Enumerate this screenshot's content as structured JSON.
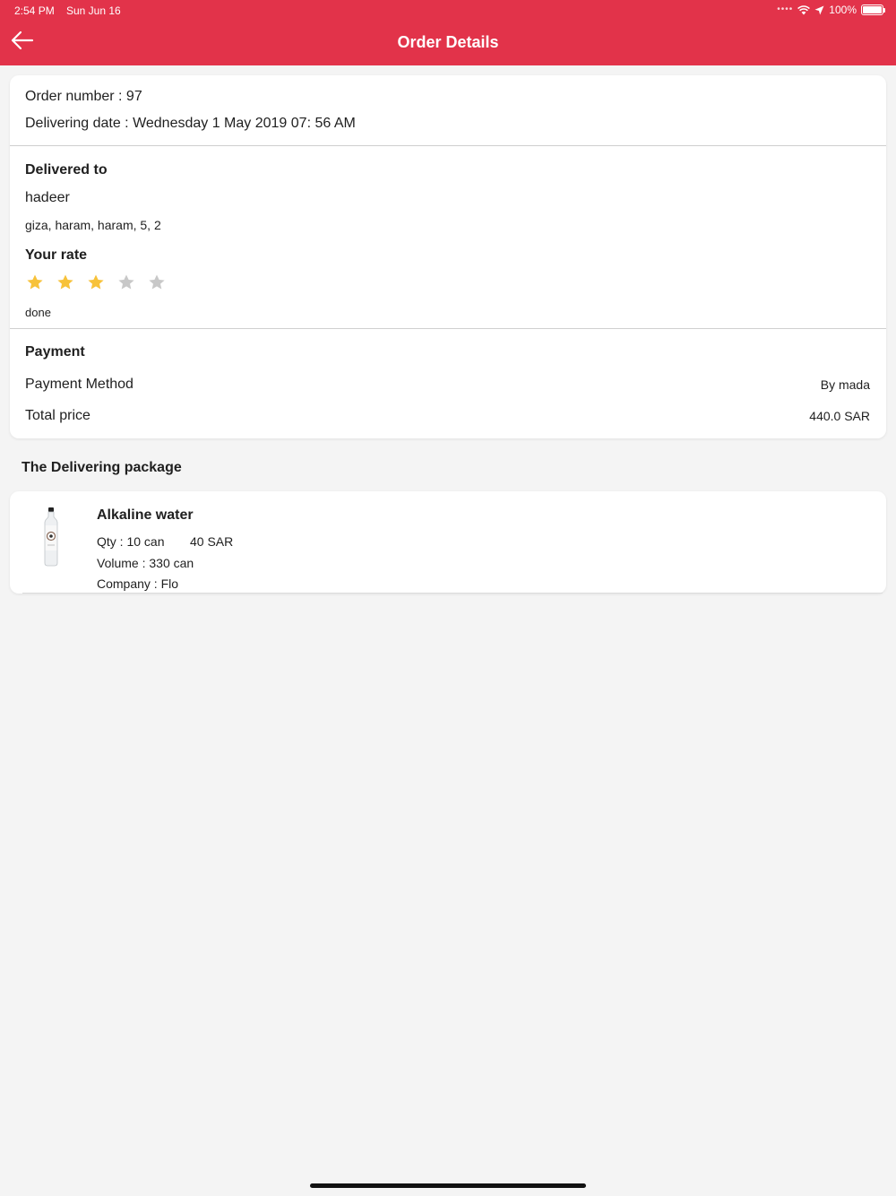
{
  "status_bar": {
    "time": "2:54 PM",
    "date": "Sun Jun 16",
    "battery": "100%"
  },
  "header": {
    "title": "Order Details",
    "back_icon": "arrow-left-icon",
    "color": "#e2334a"
  },
  "order": {
    "number_label": "Order number : 97",
    "date_label": "Delivering date : Wednesday 1 May 2019 07: 56 AM"
  },
  "delivery": {
    "heading": "Delivered to",
    "name": "hadeer",
    "address": "giza, haram, haram, 5, 2"
  },
  "rating": {
    "heading": "Your rate",
    "value": 3,
    "max": 5,
    "status": "done",
    "filled_color": "#f7c23a",
    "empty_color": "#c8c8c8"
  },
  "payment": {
    "heading": "Payment",
    "method_label": "Payment Method",
    "method_value": "By mada",
    "total_label": "Total price",
    "total_value": "440.0 SAR"
  },
  "package": {
    "heading": "The Delivering package",
    "items": [
      {
        "name": "Alkaline water",
        "qty": "Qty : 10 can",
        "price": "40 SAR",
        "volume": "Volume : 330 can",
        "company": "Company : Flo",
        "image_icon": "water-bottle-icon"
      }
    ]
  }
}
